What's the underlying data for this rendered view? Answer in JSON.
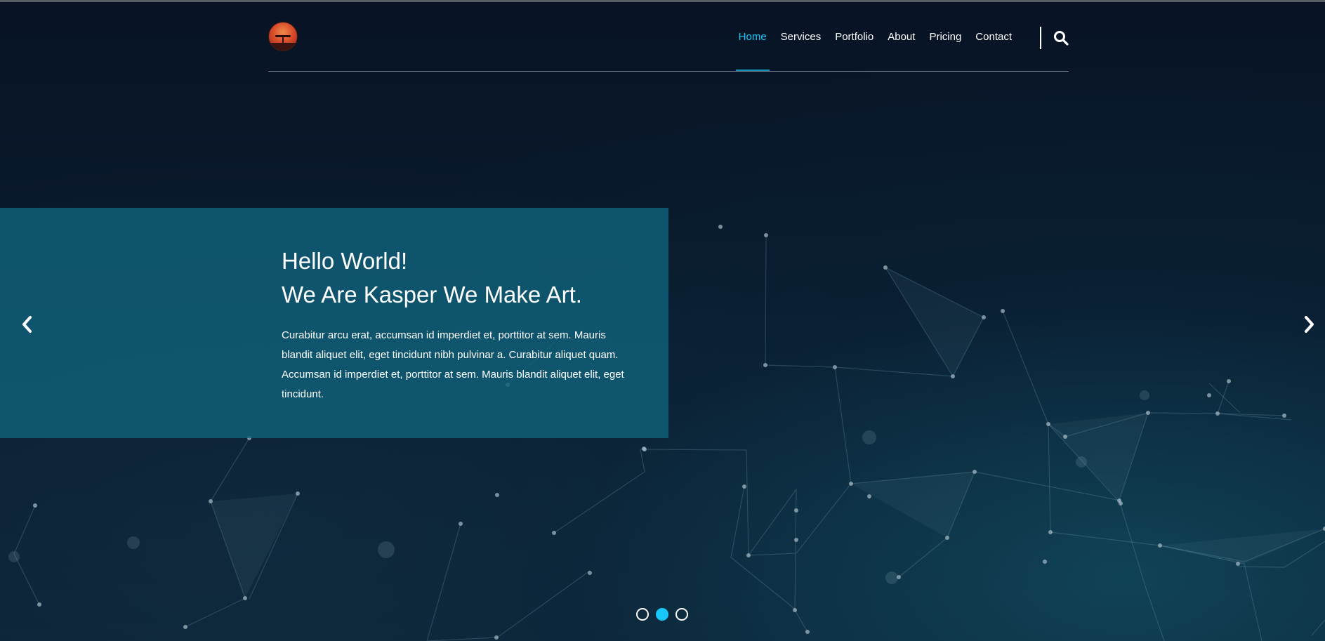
{
  "header": {
    "logo_icon": "sunset-tree-logo",
    "nav": [
      {
        "label": "Home",
        "active": true
      },
      {
        "label": "Services",
        "active": false
      },
      {
        "label": "Portfolio",
        "active": false
      },
      {
        "label": "About",
        "active": false
      },
      {
        "label": "Pricing",
        "active": false
      },
      {
        "label": "Contact",
        "active": false
      }
    ],
    "search_icon": "search-icon"
  },
  "slider": {
    "title_line1": "Hello World!",
    "title_line2": "We Are Kasper We Make Art.",
    "description": "Curabitur arcu erat, accumsan id imperdiet et, porttitor at sem. Mauris blandit aliquet elit, eget tincidunt nibh pulvinar a. Curabitur aliquet quam. Accumsan id imperdiet et, porttitor at sem. Mauris blandit aliquet elit, eget tincidunt.",
    "prev_icon": "chevron-left-icon",
    "next_icon": "chevron-right-icon",
    "bullets_total": 3,
    "active_bullet": 2
  },
  "colors": {
    "accent": "#19c8fa",
    "promo_bg": "#10607a",
    "background": "#0a1628",
    "text": "#ffffff"
  }
}
